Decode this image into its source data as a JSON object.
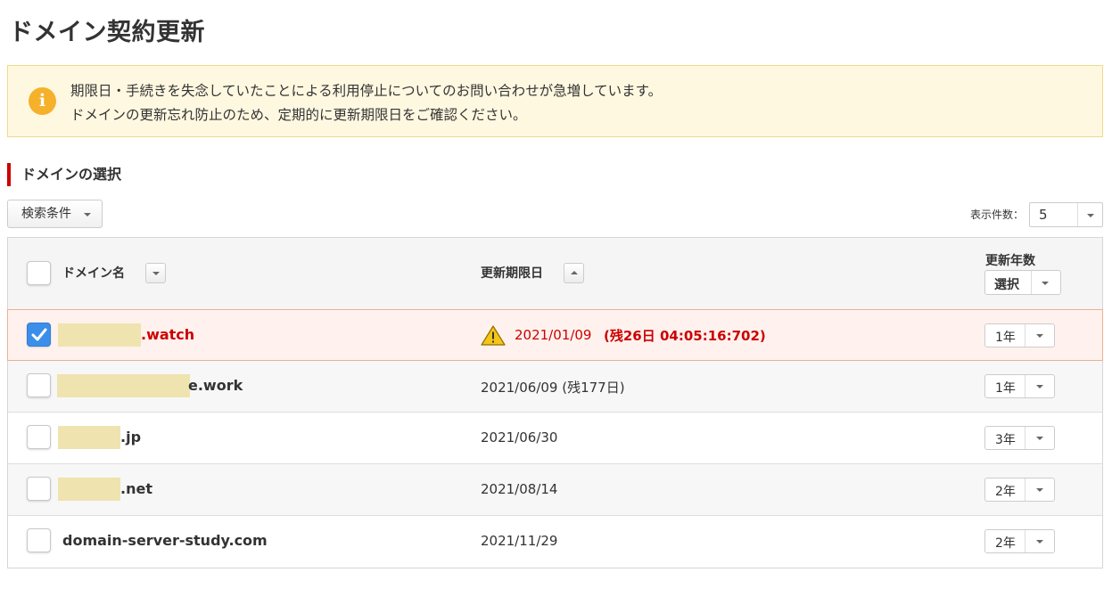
{
  "page": {
    "title": "ドメイン契約更新"
  },
  "notice": {
    "icon": "info-icon",
    "line1": "期限日・手続きを失念していたことによる利用停止についてのお問い合わせが急増しています。",
    "line2": "ドメインの更新忘れ防止のため、定期的に更新期限日をご確認ください。"
  },
  "section": {
    "title": "ドメインの選択"
  },
  "filter": {
    "label": "検索条件"
  },
  "per_page": {
    "label": "表示件数：",
    "value": "5"
  },
  "table": {
    "col_domain": "ドメイン名",
    "col_date": "更新期限日",
    "col_years": "更新年数",
    "years_all_label": "選択",
    "rows": [
      {
        "domain_suffix": ".watch",
        "date": "2021/01/09",
        "remaining": "(残26日 04:05:16:702)",
        "years": "1年",
        "checked": true,
        "warning": true
      },
      {
        "domain_suffix": "e.work",
        "date": "2021/06/09 (残177日)",
        "years": "1年",
        "checked": false
      },
      {
        "domain_suffix": ".jp",
        "date": "2021/06/30",
        "years": "3年",
        "checked": false
      },
      {
        "domain_suffix": ".net",
        "date": "2021/08/14",
        "years": "2年",
        "checked": false
      },
      {
        "domain": "domain-server-study.com",
        "date": "2021/11/29",
        "years": "2年",
        "checked": false
      }
    ]
  },
  "colors": {
    "accent_red": "#cc0000",
    "notice_bg": "#fff8e1",
    "checkbox_blue": "#3b8fea",
    "warning_yellow": "#f5c518"
  }
}
